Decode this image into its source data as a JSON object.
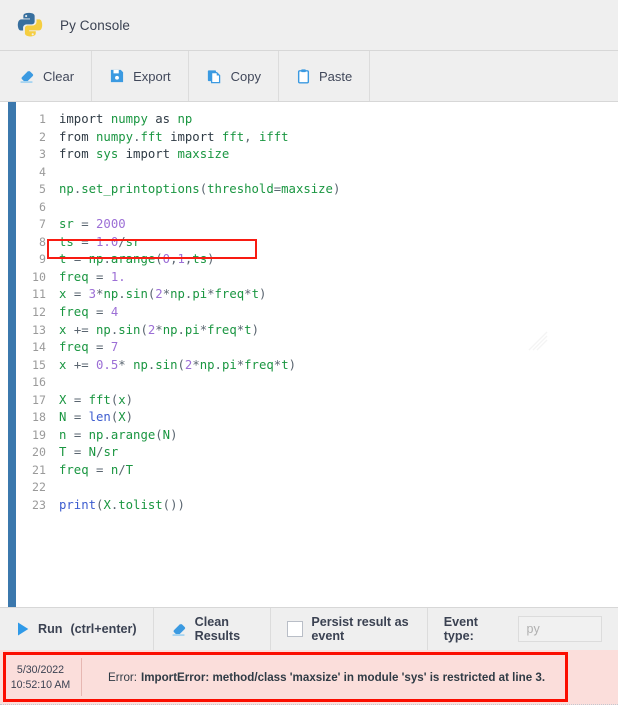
{
  "header": {
    "title": "Py Console",
    "logo_icon": "python-logo-icon"
  },
  "toolbar": {
    "buttons": [
      {
        "label": "Clear",
        "icon": "eraser-icon"
      },
      {
        "label": "Export",
        "icon": "floppy-disk-icon"
      },
      {
        "label": "Copy",
        "icon": "copy-icon"
      },
      {
        "label": "Paste",
        "icon": "clipboard-icon"
      }
    ]
  },
  "editor": {
    "language": "python",
    "highlighted_line": 3,
    "lines": [
      {
        "n": "1",
        "tokens": [
          {
            "t": "import",
            "c": "kw"
          },
          {
            "t": " ",
            "c": "plain"
          },
          {
            "t": "numpy",
            "c": "name"
          },
          {
            "t": " ",
            "c": "plain"
          },
          {
            "t": "as",
            "c": "kw"
          },
          {
            "t": " ",
            "c": "plain"
          },
          {
            "t": "np",
            "c": "name"
          }
        ]
      },
      {
        "n": "2",
        "tokens": [
          {
            "t": "from",
            "c": "kw"
          },
          {
            "t": " ",
            "c": "plain"
          },
          {
            "t": "numpy",
            "c": "name"
          },
          {
            "t": ".",
            "c": "punc"
          },
          {
            "t": "fft",
            "c": "name"
          },
          {
            "t": " ",
            "c": "plain"
          },
          {
            "t": "import",
            "c": "kw"
          },
          {
            "t": " ",
            "c": "plain"
          },
          {
            "t": "fft",
            "c": "name"
          },
          {
            "t": ",",
            "c": "punc"
          },
          {
            "t": " ",
            "c": "plain"
          },
          {
            "t": "ifft",
            "c": "name"
          }
        ]
      },
      {
        "n": "3",
        "tokens": [
          {
            "t": "from",
            "c": "kw"
          },
          {
            "t": " ",
            "c": "plain"
          },
          {
            "t": "sys",
            "c": "name"
          },
          {
            "t": " ",
            "c": "plain"
          },
          {
            "t": "import",
            "c": "kw"
          },
          {
            "t": " ",
            "c": "plain"
          },
          {
            "t": "maxsize",
            "c": "name"
          }
        ]
      },
      {
        "n": "4",
        "tokens": []
      },
      {
        "n": "5",
        "tokens": [
          {
            "t": "np",
            "c": "name"
          },
          {
            "t": ".",
            "c": "punc"
          },
          {
            "t": "set_printoptions",
            "c": "name"
          },
          {
            "t": "(",
            "c": "punc"
          },
          {
            "t": "threshold",
            "c": "name"
          },
          {
            "t": "=",
            "c": "op"
          },
          {
            "t": "maxsize",
            "c": "name"
          },
          {
            "t": ")",
            "c": "punc"
          }
        ]
      },
      {
        "n": "6",
        "tokens": []
      },
      {
        "n": "7",
        "tokens": [
          {
            "t": "sr",
            "c": "name"
          },
          {
            "t": " ",
            "c": "plain"
          },
          {
            "t": "=",
            "c": "op"
          },
          {
            "t": " ",
            "c": "plain"
          },
          {
            "t": "2000",
            "c": "num"
          }
        ]
      },
      {
        "n": "8",
        "tokens": [
          {
            "t": "ts",
            "c": "name"
          },
          {
            "t": " ",
            "c": "plain"
          },
          {
            "t": "=",
            "c": "op"
          },
          {
            "t": " ",
            "c": "plain"
          },
          {
            "t": "1.0",
            "c": "num"
          },
          {
            "t": "/",
            "c": "op"
          },
          {
            "t": "sr",
            "c": "name"
          }
        ]
      },
      {
        "n": "9",
        "tokens": [
          {
            "t": "t",
            "c": "name"
          },
          {
            "t": " ",
            "c": "plain"
          },
          {
            "t": "=",
            "c": "op"
          },
          {
            "t": " ",
            "c": "plain"
          },
          {
            "t": "np",
            "c": "name"
          },
          {
            "t": ".",
            "c": "punc"
          },
          {
            "t": "arange",
            "c": "name"
          },
          {
            "t": "(",
            "c": "punc"
          },
          {
            "t": "0",
            "c": "num"
          },
          {
            "t": ",",
            "c": "punc"
          },
          {
            "t": "1",
            "c": "num"
          },
          {
            "t": ",",
            "c": "punc"
          },
          {
            "t": "ts",
            "c": "name"
          },
          {
            "t": ")",
            "c": "punc"
          }
        ]
      },
      {
        "n": "10",
        "tokens": [
          {
            "t": "freq",
            "c": "name"
          },
          {
            "t": " ",
            "c": "plain"
          },
          {
            "t": "=",
            "c": "op"
          },
          {
            "t": " ",
            "c": "plain"
          },
          {
            "t": "1.",
            "c": "num"
          }
        ]
      },
      {
        "n": "11",
        "tokens": [
          {
            "t": "x",
            "c": "name"
          },
          {
            "t": " ",
            "c": "plain"
          },
          {
            "t": "=",
            "c": "op"
          },
          {
            "t": " ",
            "c": "plain"
          },
          {
            "t": "3",
            "c": "num"
          },
          {
            "t": "*",
            "c": "op"
          },
          {
            "t": "np",
            "c": "name"
          },
          {
            "t": ".",
            "c": "punc"
          },
          {
            "t": "sin",
            "c": "name"
          },
          {
            "t": "(",
            "c": "punc"
          },
          {
            "t": "2",
            "c": "num"
          },
          {
            "t": "*",
            "c": "op"
          },
          {
            "t": "np",
            "c": "name"
          },
          {
            "t": ".",
            "c": "punc"
          },
          {
            "t": "pi",
            "c": "name"
          },
          {
            "t": "*",
            "c": "op"
          },
          {
            "t": "freq",
            "c": "name"
          },
          {
            "t": "*",
            "c": "op"
          },
          {
            "t": "t",
            "c": "name"
          },
          {
            "t": ")",
            "c": "punc"
          }
        ]
      },
      {
        "n": "12",
        "tokens": [
          {
            "t": "freq",
            "c": "name"
          },
          {
            "t": " ",
            "c": "plain"
          },
          {
            "t": "=",
            "c": "op"
          },
          {
            "t": " ",
            "c": "plain"
          },
          {
            "t": "4",
            "c": "num"
          }
        ]
      },
      {
        "n": "13",
        "tokens": [
          {
            "t": "x",
            "c": "name"
          },
          {
            "t": " ",
            "c": "plain"
          },
          {
            "t": "+=",
            "c": "op"
          },
          {
            "t": " ",
            "c": "plain"
          },
          {
            "t": "np",
            "c": "name"
          },
          {
            "t": ".",
            "c": "punc"
          },
          {
            "t": "sin",
            "c": "name"
          },
          {
            "t": "(",
            "c": "punc"
          },
          {
            "t": "2",
            "c": "num"
          },
          {
            "t": "*",
            "c": "op"
          },
          {
            "t": "np",
            "c": "name"
          },
          {
            "t": ".",
            "c": "punc"
          },
          {
            "t": "pi",
            "c": "name"
          },
          {
            "t": "*",
            "c": "op"
          },
          {
            "t": "freq",
            "c": "name"
          },
          {
            "t": "*",
            "c": "op"
          },
          {
            "t": "t",
            "c": "name"
          },
          {
            "t": ")",
            "c": "punc"
          }
        ]
      },
      {
        "n": "14",
        "tokens": [
          {
            "t": "freq",
            "c": "name"
          },
          {
            "t": " ",
            "c": "plain"
          },
          {
            "t": "=",
            "c": "op"
          },
          {
            "t": " ",
            "c": "plain"
          },
          {
            "t": "7",
            "c": "num"
          }
        ]
      },
      {
        "n": "15",
        "tokens": [
          {
            "t": "x",
            "c": "name"
          },
          {
            "t": " ",
            "c": "plain"
          },
          {
            "t": "+=",
            "c": "op"
          },
          {
            "t": " ",
            "c": "plain"
          },
          {
            "t": "0.5",
            "c": "num"
          },
          {
            "t": "*",
            "c": "op"
          },
          {
            "t": " ",
            "c": "plain"
          },
          {
            "t": "np",
            "c": "name"
          },
          {
            "t": ".",
            "c": "punc"
          },
          {
            "t": "sin",
            "c": "name"
          },
          {
            "t": "(",
            "c": "punc"
          },
          {
            "t": "2",
            "c": "num"
          },
          {
            "t": "*",
            "c": "op"
          },
          {
            "t": "np",
            "c": "name"
          },
          {
            "t": ".",
            "c": "punc"
          },
          {
            "t": "pi",
            "c": "name"
          },
          {
            "t": "*",
            "c": "op"
          },
          {
            "t": "freq",
            "c": "name"
          },
          {
            "t": "*",
            "c": "op"
          },
          {
            "t": "t",
            "c": "name"
          },
          {
            "t": ")",
            "c": "punc"
          }
        ]
      },
      {
        "n": "16",
        "tokens": []
      },
      {
        "n": "17",
        "tokens": [
          {
            "t": "X",
            "c": "name"
          },
          {
            "t": " ",
            "c": "plain"
          },
          {
            "t": "=",
            "c": "op"
          },
          {
            "t": " ",
            "c": "plain"
          },
          {
            "t": "fft",
            "c": "name"
          },
          {
            "t": "(",
            "c": "punc"
          },
          {
            "t": "x",
            "c": "name"
          },
          {
            "t": ")",
            "c": "punc"
          }
        ]
      },
      {
        "n": "18",
        "tokens": [
          {
            "t": "N",
            "c": "name"
          },
          {
            "t": " ",
            "c": "plain"
          },
          {
            "t": "=",
            "c": "op"
          },
          {
            "t": " ",
            "c": "plain"
          },
          {
            "t": "len",
            "c": "builtin"
          },
          {
            "t": "(",
            "c": "punc"
          },
          {
            "t": "X",
            "c": "name"
          },
          {
            "t": ")",
            "c": "punc"
          }
        ]
      },
      {
        "n": "19",
        "tokens": [
          {
            "t": "n",
            "c": "name"
          },
          {
            "t": " ",
            "c": "plain"
          },
          {
            "t": "=",
            "c": "op"
          },
          {
            "t": " ",
            "c": "plain"
          },
          {
            "t": "np",
            "c": "name"
          },
          {
            "t": ".",
            "c": "punc"
          },
          {
            "t": "arange",
            "c": "name"
          },
          {
            "t": "(",
            "c": "punc"
          },
          {
            "t": "N",
            "c": "name"
          },
          {
            "t": ")",
            "c": "punc"
          }
        ]
      },
      {
        "n": "20",
        "tokens": [
          {
            "t": "T",
            "c": "name"
          },
          {
            "t": " ",
            "c": "plain"
          },
          {
            "t": "=",
            "c": "op"
          },
          {
            "t": " ",
            "c": "plain"
          },
          {
            "t": "N",
            "c": "name"
          },
          {
            "t": "/",
            "c": "op"
          },
          {
            "t": "sr",
            "c": "name"
          }
        ]
      },
      {
        "n": "21",
        "tokens": [
          {
            "t": "freq",
            "c": "name"
          },
          {
            "t": " ",
            "c": "plain"
          },
          {
            "t": "=",
            "c": "op"
          },
          {
            "t": " ",
            "c": "plain"
          },
          {
            "t": "n",
            "c": "name"
          },
          {
            "t": "/",
            "c": "op"
          },
          {
            "t": "T",
            "c": "name"
          }
        ]
      },
      {
        "n": "22",
        "tokens": []
      },
      {
        "n": "23",
        "tokens": [
          {
            "t": "print",
            "c": "builtin"
          },
          {
            "t": "(",
            "c": "punc"
          },
          {
            "t": "X",
            "c": "name"
          },
          {
            "t": ".",
            "c": "punc"
          },
          {
            "t": "tolist",
            "c": "name"
          },
          {
            "t": "(",
            "c": "punc"
          },
          {
            "t": ")",
            "c": "punc"
          },
          {
            "t": ")",
            "c": "punc"
          }
        ]
      }
    ]
  },
  "runbar": {
    "run_label": "Run",
    "run_hint": "(ctrl+enter)",
    "run_icon": "play-triangle-icon",
    "clean_label": "Clean Results",
    "clean_icon": "eraser-icon",
    "persist_label": "Persist result as event",
    "persist_checked": false,
    "event_type_label": "Event type:",
    "event_type_value": "",
    "event_type_placeholder": "py"
  },
  "result": {
    "date": "5/30/2022",
    "time": "10:52:10 AM",
    "message_prefix": "Error:",
    "message": "ImportError: method/class 'maxsize' in module 'sys' is restricted at line 3."
  },
  "colors": {
    "accent_blue": "#3b9ae1",
    "gutter_blue": "#3b78ad",
    "annotation_red": "#fb0d00",
    "error_bg": "#fbdedb",
    "chrome_gray": "#efefef"
  }
}
